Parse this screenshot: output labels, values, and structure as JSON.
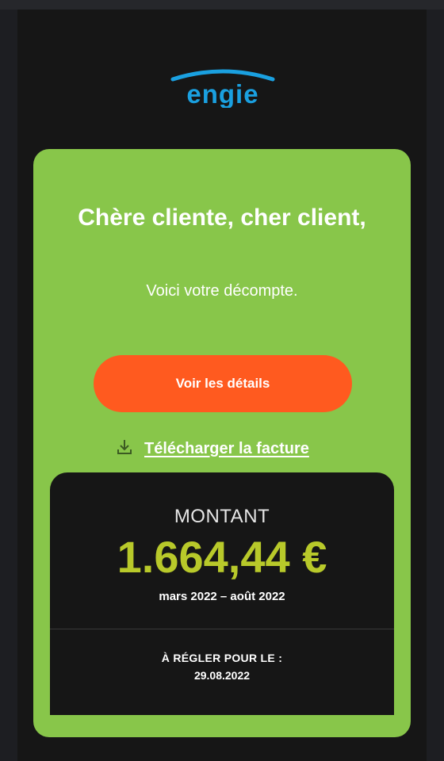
{
  "brand": {
    "logo_text": "ENGIE",
    "logo_color": "#1aa0e0"
  },
  "card": {
    "greeting": "Chère cliente, cher client,",
    "subtitle": "Voici votre décompte.",
    "details_button": "Voir les détails",
    "download_icon": "download-icon",
    "download_link": "Télécharger la facture",
    "accent_color": "#88c64a",
    "button_color": "#ff5a1f"
  },
  "summary": {
    "amount_label": "MONTANT",
    "amount": "1.664,44 €",
    "period": "mars 2022 – août 2022",
    "due_label": "À RÉGLER POUR LE :",
    "due_date": "29.08.2022",
    "amount_color": "#b8c92a"
  }
}
